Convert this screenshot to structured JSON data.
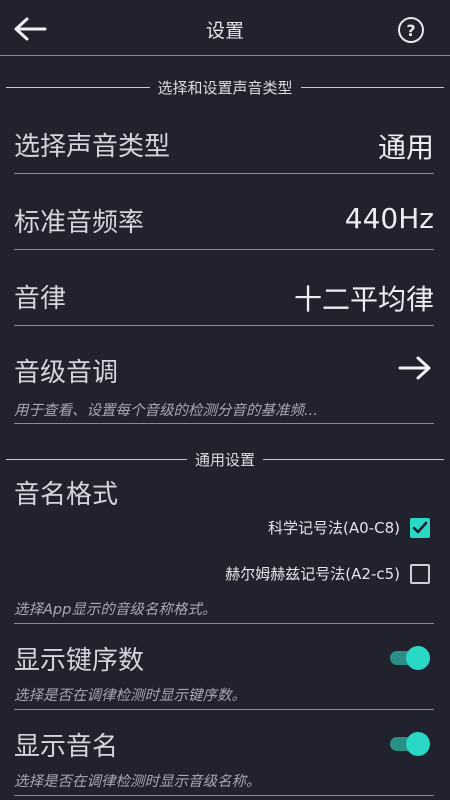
{
  "header": {
    "title": "设置",
    "back_icon": "arrow-left-icon",
    "help_symbol": "?"
  },
  "section_sound": {
    "title": "选择和设置声音类型"
  },
  "sound_type": {
    "label": "选择声音类型",
    "value": "通用"
  },
  "standard_freq": {
    "label": "标准音频率",
    "value": "440Hz"
  },
  "temperament": {
    "label": "音律",
    "value": "十二平均律"
  },
  "pitch_tuning": {
    "label": "音级音调",
    "desc": "用于查看、设置每个音级的检测分音的基准频..."
  },
  "section_general": {
    "title": "通用设置"
  },
  "note_format": {
    "label": "音名格式",
    "option_scientific": {
      "label": "科学记号法(A0-C8)",
      "checked": true
    },
    "option_helmholtz": {
      "label": "赫尔姆赫兹记号法(A2-c5)",
      "checked": false
    },
    "desc": "选择App显示的音级名称格式。"
  },
  "show_key_number": {
    "label": "显示键序数",
    "enabled": true,
    "desc": "选择是否在调律检测时显示键序数。"
  },
  "show_note_name": {
    "label": "显示音名",
    "enabled": true,
    "desc": "选择是否在调律检测时显示音级名称。"
  },
  "colors": {
    "background": "#22222e",
    "accent": "#2ad8c6",
    "divider": "#8a8a94"
  }
}
